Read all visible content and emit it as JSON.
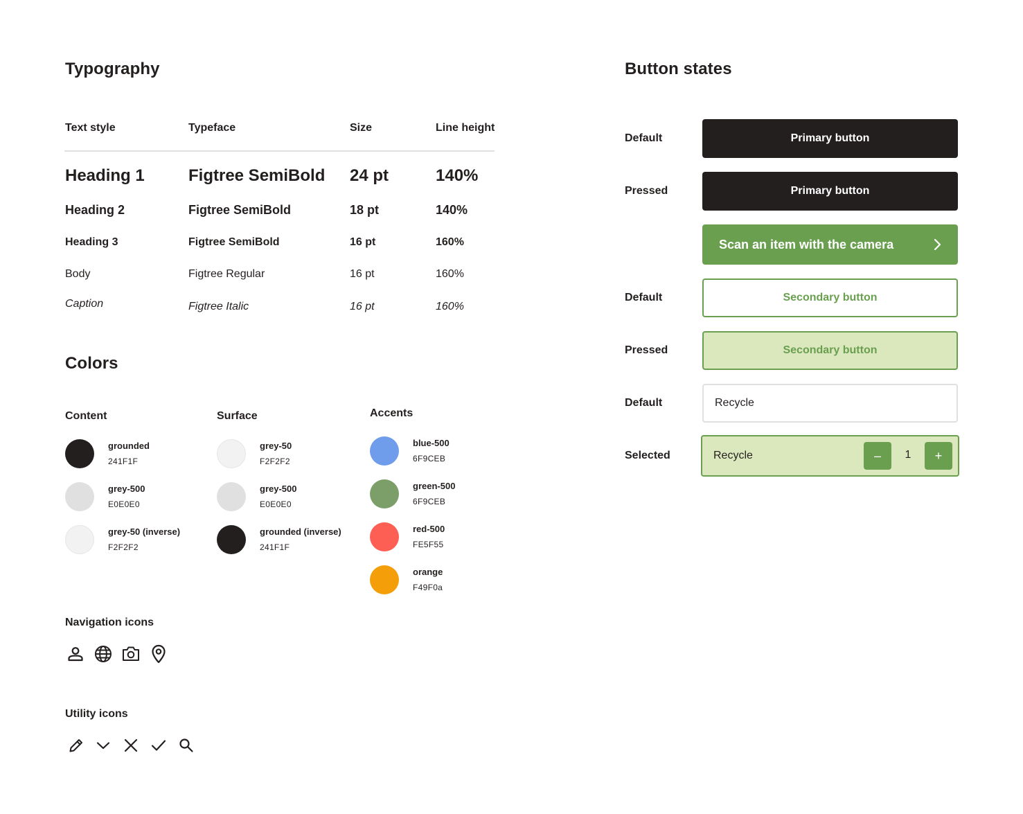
{
  "typography": {
    "title": "Typography",
    "headers": [
      "Text style",
      "Typeface",
      "Size",
      "Line height"
    ],
    "rows": [
      {
        "style": "Heading 1",
        "typeface": "Figtree SemiBold",
        "size": "24 pt",
        "line_height": "140%"
      },
      {
        "style": "Heading 2",
        "typeface": "Figtree SemiBold",
        "size": "18 pt",
        "line_height": "140%"
      },
      {
        "style": "Heading 3",
        "typeface": "Figtree SemiBold",
        "size": "16 pt",
        "line_height": "160%"
      },
      {
        "style": "Body",
        "typeface": "Figtree Regular",
        "size": "16 pt",
        "line_height": "160%"
      },
      {
        "style": "Caption",
        "typeface": "Figtree Italic",
        "size": "16 pt",
        "line_height": "160%"
      }
    ]
  },
  "colors": {
    "title": "Colors",
    "groups": [
      {
        "title": "Content",
        "swatches": [
          {
            "name": "grounded",
            "hex": "241F1F",
            "color": "#241F1F"
          },
          {
            "name": "grey-500",
            "hex": "E0E0E0",
            "color": "#E0E0E0"
          },
          {
            "name": "grey-50 (inverse)",
            "hex": "F2F2F2",
            "color": "#F2F2F2"
          }
        ]
      },
      {
        "title": "Surface",
        "swatches": [
          {
            "name": "grey-50",
            "hex": "F2F2F2",
            "color": "#F2F2F2"
          },
          {
            "name": "grey-500",
            "hex": "E0E0E0",
            "color": "#E0E0E0"
          },
          {
            "name": "grounded (inverse)",
            "hex": "241F1F",
            "color": "#241F1F"
          }
        ]
      },
      {
        "title": "Accents",
        "swatches": [
          {
            "name": "blue-500",
            "hex": "6F9CEB",
            "color": "#6F9CEB"
          },
          {
            "name": "green-500",
            "hex": "6F9CEB",
            "color": "#7C9F69"
          },
          {
            "name": "red-500",
            "hex": "FE5F55",
            "color": "#FE5F55"
          },
          {
            "name": "orange",
            "hex": "F49F0a",
            "color": "#F49F0A"
          }
        ]
      }
    ]
  },
  "navigation_icons": {
    "title": "Navigation icons",
    "icons": [
      "user-icon",
      "globe-icon",
      "camera-icon",
      "map-pin-icon"
    ]
  },
  "utility_icons": {
    "title": "Utility icons",
    "icons": [
      "pencil-icon",
      "chevron-down-icon",
      "close-icon",
      "check-icon",
      "search-icon"
    ]
  },
  "button_states": {
    "title": "Button states",
    "primary": {
      "default_state": "Default",
      "pressed_state": "Pressed",
      "label": "Primary button",
      "color": "#241F1F"
    },
    "scan": {
      "label": "Scan an item with the camera",
      "icon": "chevron-right-icon",
      "color": "#6A9F50"
    },
    "secondary": {
      "default_state": "Default",
      "pressed_state": "Pressed",
      "label": "Secondary button",
      "pressed_fill": "#DBE8BD"
    },
    "option": {
      "default_state": "Default",
      "selected_state": "Selected",
      "label": "Recycle",
      "quantity": "1",
      "minus": "–",
      "plus": "+"
    }
  }
}
